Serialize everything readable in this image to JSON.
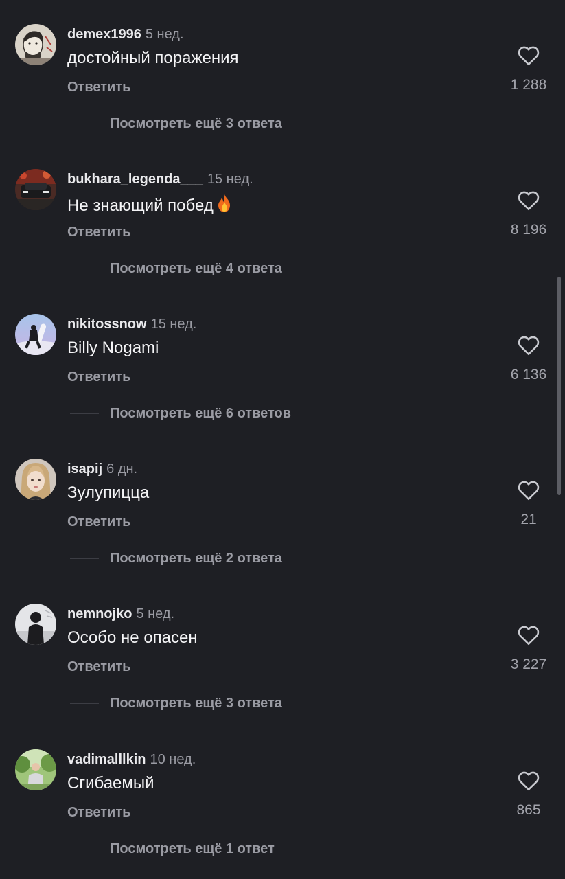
{
  "comments": [
    {
      "username": "demex1996",
      "time": "5 нед.",
      "text": "достойный поражения",
      "reply_label": "Ответить",
      "likes": "1 288",
      "more_replies": "Посмотреть ещё 3 ответа",
      "avatar_icon": "avatar-sketch-man"
    },
    {
      "username": "bukhara_legenda___",
      "time": "15 нед.",
      "text": "Не знающий побед",
      "emoji_icon": "fire-emoji",
      "reply_label": "Ответить",
      "likes": "8 196",
      "more_replies": "Посмотреть ещё 4 ответа",
      "avatar_icon": "avatar-car"
    },
    {
      "username": "nikitossnow",
      "time": "15 нед.",
      "text": "Billy Nogami",
      "reply_label": "Ответить",
      "likes": "6 136",
      "more_replies": "Посмотреть ещё 6 ответов",
      "avatar_icon": "avatar-snowboarder"
    },
    {
      "username": "isapij",
      "time": "6 дн.",
      "text": "Зулупицца",
      "reply_label": "Ответить",
      "likes": "21",
      "more_replies": "Посмотреть ещё 2 ответа",
      "avatar_icon": "avatar-girl"
    },
    {
      "username": "nemnojko",
      "time": "5 нед.",
      "text": "Особо не опасен",
      "reply_label": "Ответить",
      "likes": "3 227",
      "more_replies": "Посмотреть ещё 3 ответа",
      "avatar_icon": "avatar-person-grey"
    },
    {
      "username": "vadimalllkin",
      "time": "10 нед.",
      "text": "Сгибаемый",
      "reply_label": "Ответить",
      "likes": "865",
      "more_replies": "Посмотреть ещё 1 ответ",
      "avatar_icon": "avatar-man-park"
    }
  ],
  "colors": {
    "background": "#1e1f24",
    "primary_text": "#f4f4f6",
    "secondary_text": "#9a9ba3",
    "scrollbar": "#5c5d64"
  }
}
